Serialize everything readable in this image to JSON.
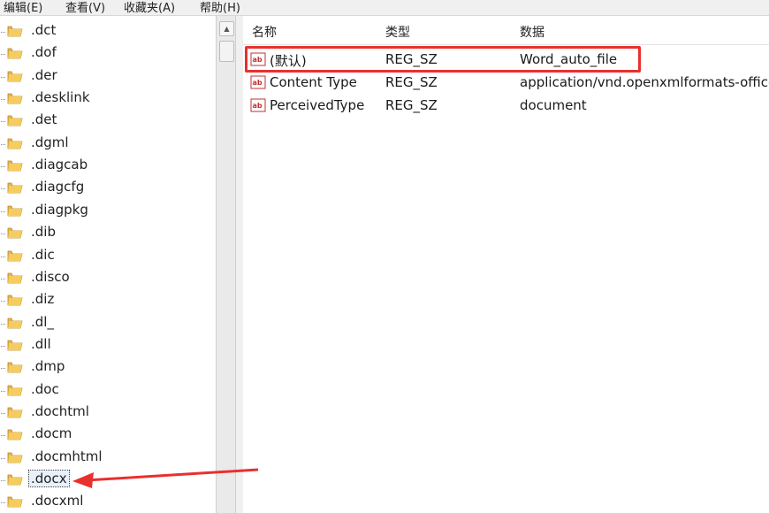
{
  "menu": [
    "编辑(E)",
    "查看(V)",
    "收藏夹(A)",
    "帮助(H)"
  ],
  "tree": {
    "items": [
      ".dct",
      ".dof",
      ".der",
      ".desklink",
      ".det",
      ".dgml",
      ".diagcab",
      ".diagcfg",
      ".diagpkg",
      ".dib",
      ".dic",
      ".disco",
      ".diz",
      ".dl_",
      ".dll",
      ".dmp",
      ".doc",
      ".dochtml",
      ".docm",
      ".docmhtml",
      ".docx",
      ".docxml"
    ],
    "selected": ".docx",
    "icon": "folder-icon"
  },
  "values": {
    "headers": {
      "name": "名称",
      "type": "类型",
      "data": "数据"
    },
    "rows": [
      {
        "name": "(默认)",
        "type": "REG_SZ",
        "data": "Word_auto_file",
        "icon": "reg-string-icon"
      },
      {
        "name": "Content Type",
        "type": "REG_SZ",
        "data": "application/vnd.openxmlformats-office",
        "icon": "reg-string-icon"
      },
      {
        "name": "PerceivedType",
        "type": "REG_SZ",
        "data": "document",
        "icon": "reg-string-icon"
      }
    ]
  },
  "annotation": {
    "highlight_color": "#e8302f"
  }
}
